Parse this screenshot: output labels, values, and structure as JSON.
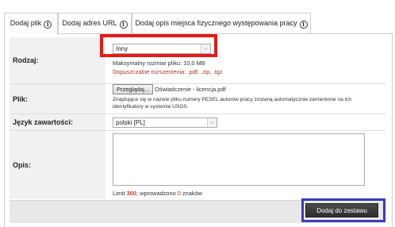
{
  "tabs": [
    {
      "label": "Dodaj plik",
      "active": true
    },
    {
      "label": "Dodaj adres URL",
      "active": false
    },
    {
      "label": "Dodaj opis miejsca fizycznego występowania pracy",
      "active": false
    }
  ],
  "form": {
    "rodzaj": {
      "label": "Rodzaj:",
      "selected": "Inny",
      "max_size": "Maksymalny rozmiar pliku: 10,0 MB",
      "allowed_ext": "Dopuszczalne rozszerzenia: .pdf, .zip, .tgz"
    },
    "plik": {
      "label": "Plik:",
      "browse_label": "Przeglądaj...",
      "file_name": "Oświadczenie - licencja.pdf",
      "note_line1": "Znajdujące się w nazwie pliku numery PESEL autorów pracy zostaną automatycznie zamienione na ich",
      "note_line2": "identyfikatory w systemie USOS."
    },
    "jezyk": {
      "label": "Język zawartości:",
      "selected": "polski [PL]"
    },
    "opis": {
      "label": "Opis:",
      "value": "",
      "limit_prefix": "Limit ",
      "limit_value": "300",
      "limit_mid": ", wprowadzono ",
      "entered_value": "0",
      "limit_suffix": " znaków"
    }
  },
  "actions": {
    "submit_label": "Dodaj do zestawu"
  },
  "colors": {
    "highlight_red": "#e31b1b",
    "highlight_blue": "#3b3bb8",
    "button_dark": "#333333"
  }
}
